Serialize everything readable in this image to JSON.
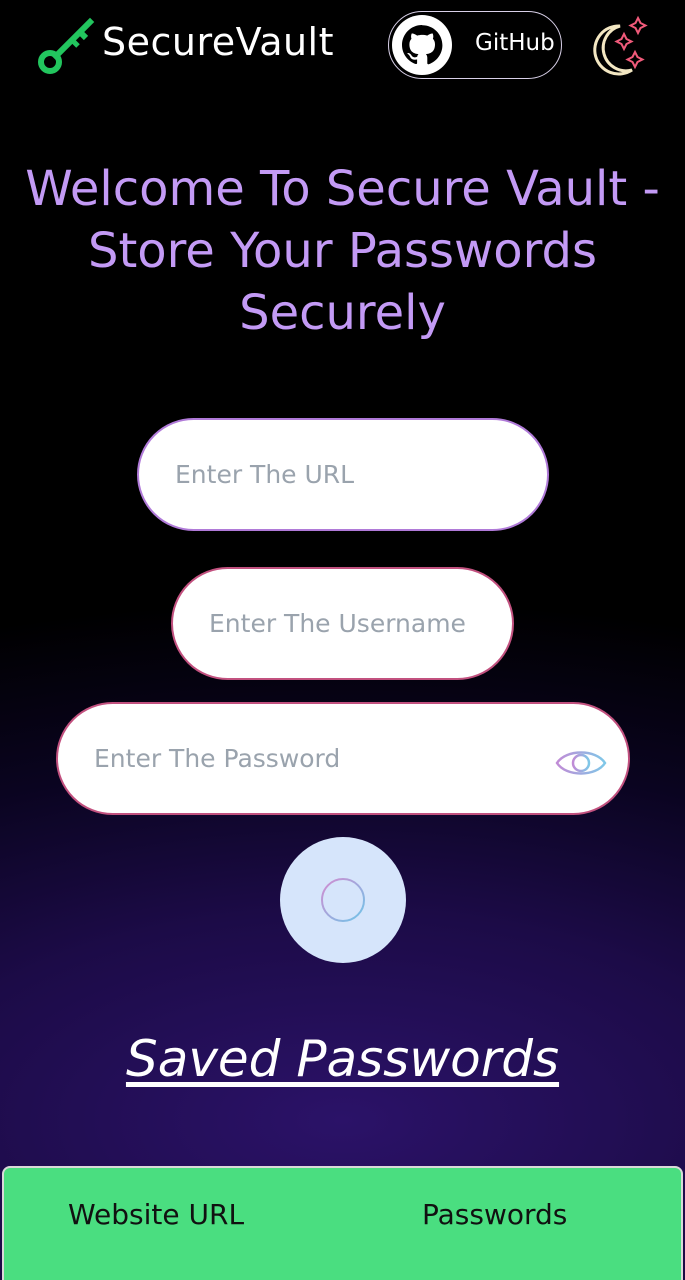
{
  "header": {
    "brand": "SecureVault",
    "github_label": "GitHub",
    "logo_icon": "key-icon",
    "theme_icon": "moon-stars-icon"
  },
  "hero": {
    "title": "Welcome To Secure Vault - Store Your Passwords Securely"
  },
  "form": {
    "url_placeholder": "Enter The URL",
    "username_placeholder": "Enter The Username",
    "password_placeholder": "Enter The Password",
    "show_password_icon": "eye-icon",
    "add_icon": "plus-circle-icon"
  },
  "saved": {
    "heading": "Saved Passwords",
    "columns": [
      "Website URL",
      "Passwords"
    ]
  },
  "colors": {
    "accent": "#c39af5",
    "table_header": "#4ade80",
    "add_button": "#d6e5fb",
    "logo_green": "#22c55e"
  }
}
